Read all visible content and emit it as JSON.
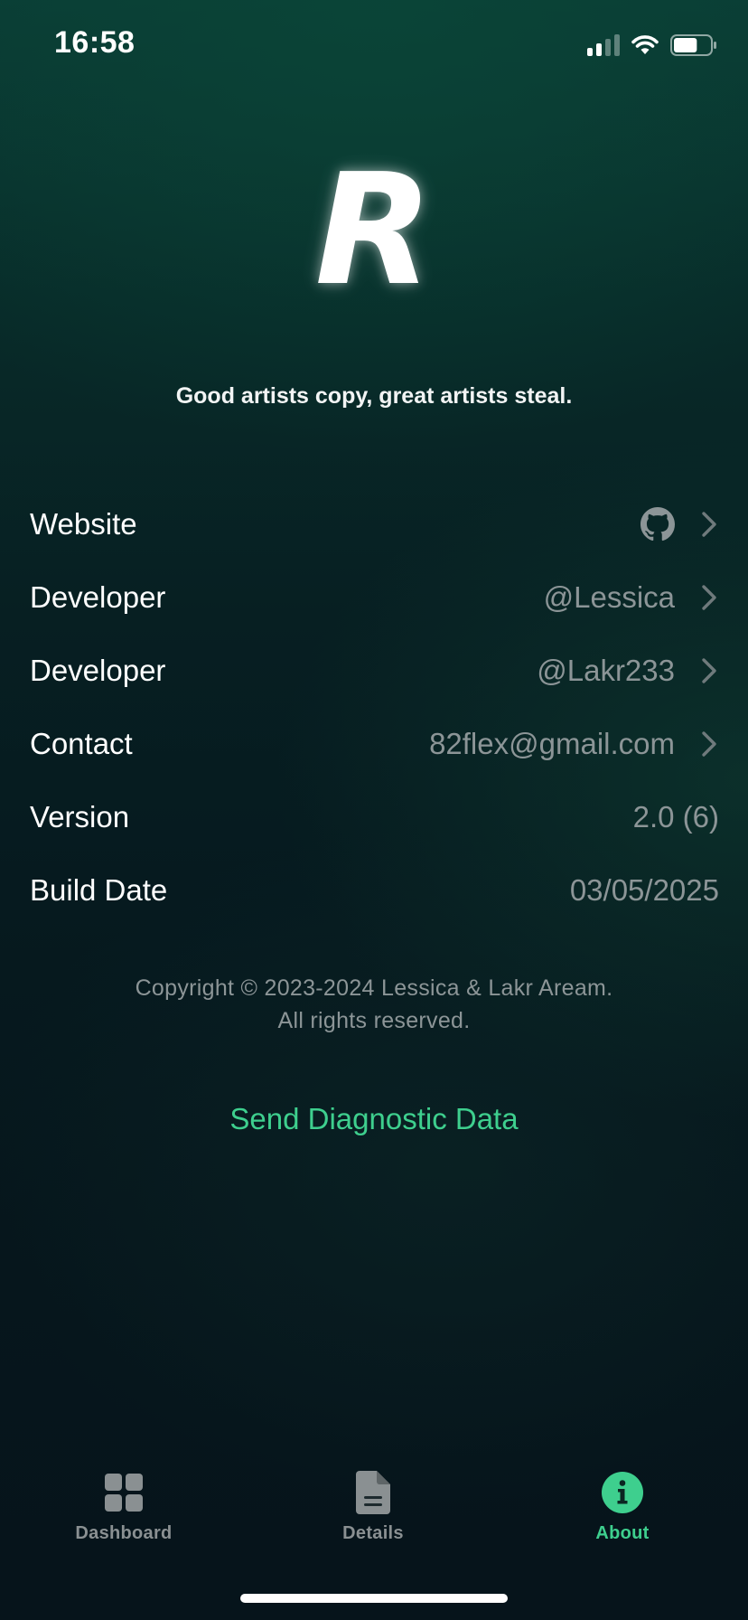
{
  "status_bar": {
    "time": "16:58",
    "icons": [
      "cellular-signal-icon",
      "wifi-icon",
      "battery-icon"
    ],
    "battery_level": 0.65
  },
  "logo": {
    "letter": "R"
  },
  "tagline": "Good artists copy, great artists steal.",
  "info_rows": [
    {
      "label": "Website",
      "value": "",
      "icon": "github-icon",
      "has_chevron": true
    },
    {
      "label": "Developer",
      "value": "@Lessica",
      "has_chevron": true
    },
    {
      "label": "Developer",
      "value": "@Lakr233",
      "has_chevron": true
    },
    {
      "label": "Contact",
      "value": "82flex@gmail.com",
      "has_chevron": true
    },
    {
      "label": "Version",
      "value": "2.0 (6)",
      "has_chevron": false
    },
    {
      "label": "Build Date",
      "value": "03/05/2025",
      "has_chevron": false
    }
  ],
  "copyright": {
    "line1": "Copyright © 2023-2024 Lessica & Lakr Aream.",
    "line2": "All rights reserved."
  },
  "diagnostic_button": "Send Diagnostic Data",
  "tabs": [
    {
      "label": "Dashboard",
      "icon": "dashboard-grid-icon",
      "active": false
    },
    {
      "label": "Details",
      "icon": "document-icon",
      "active": false
    },
    {
      "label": "About",
      "icon": "info-icon",
      "active": true
    }
  ],
  "colors": {
    "accent": "#3ecf8e",
    "secondary_text": "#8c9597",
    "background_top": "#0a3b34",
    "background_bottom": "#06141b"
  }
}
